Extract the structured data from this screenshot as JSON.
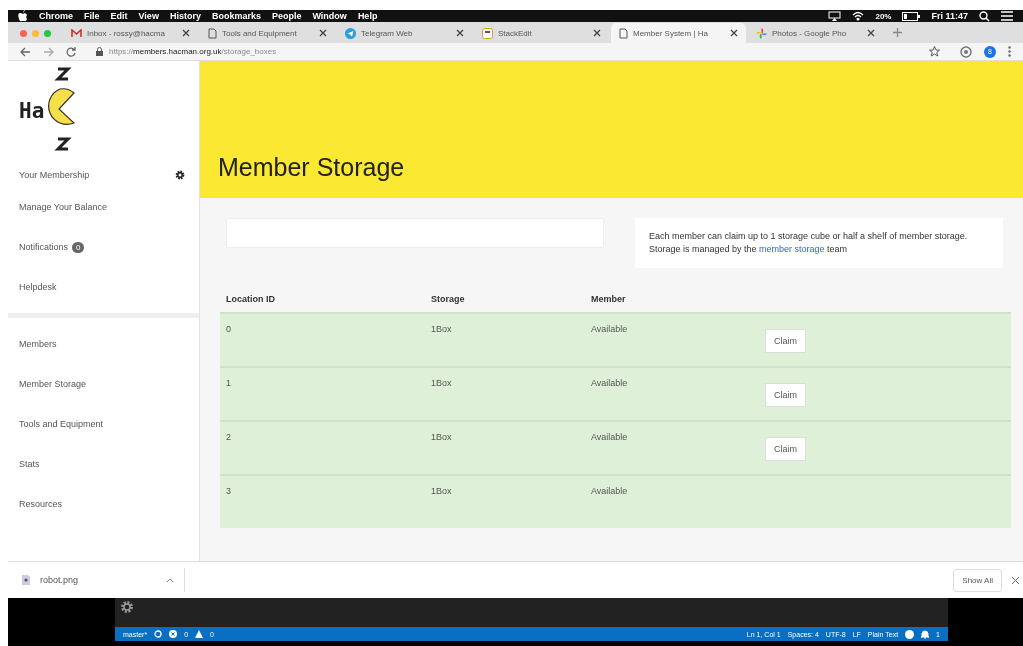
{
  "menu_bar": {
    "app": "Chrome",
    "items": [
      "File",
      "Edit",
      "View",
      "History",
      "Bookmarks",
      "People",
      "Window",
      "Help"
    ],
    "battery": "20%",
    "clock": "Fri 11:47"
  },
  "tabs": [
    {
      "label": "Inbox - rossy@hacma",
      "kind": "mail",
      "selected": false
    },
    {
      "label": "Tools and Equipment",
      "kind": "doc",
      "selected": false
    },
    {
      "label": "Telegram Web",
      "kind": "telegram",
      "selected": false
    },
    {
      "label": "StackEdit",
      "kind": "stackedit",
      "selected": false
    },
    {
      "label": "Member System | Ha",
      "kind": "doc",
      "selected": true
    },
    {
      "label": "Photos - Google Pho",
      "kind": "photos",
      "selected": false
    }
  ],
  "address_bar": {
    "scheme": "https://",
    "host": "members.hacman.org.uk",
    "path": "/storage_boxes",
    "profile": "8"
  },
  "logo": {
    "text": "Ha"
  },
  "sidebar": {
    "sections": [
      [
        {
          "label": "Your Membership",
          "kind": "settings"
        },
        {
          "label": "Manage Your Balance",
          "kind": "plain"
        },
        {
          "label": "Notifications",
          "kind": "badge",
          "badge": "0"
        },
        {
          "label": "Helpdesk",
          "kind": "plain"
        }
      ],
      [
        {
          "label": "Members",
          "kind": "plain"
        },
        {
          "label": "Member Storage",
          "kind": "plain"
        },
        {
          "label": "Tools and Equipment",
          "kind": "plain"
        },
        {
          "label": "Stats",
          "kind": "plain"
        },
        {
          "label": "Resources",
          "kind": "plain"
        }
      ]
    ]
  },
  "page": {
    "title": "Member Storage",
    "info": {
      "line1": "Each member can claim up to 1 storage cube or half a shelf of member storage.",
      "line2_before": "Storage is managed by the",
      "link": "member storage",
      "line2_after": "team"
    }
  },
  "table": {
    "columns": [
      "Location ID",
      "Storage",
      "Member"
    ],
    "rows": [
      {
        "location": "0",
        "storage": "1Box",
        "member": "Available",
        "action": "Claim"
      },
      {
        "location": "1",
        "storage": "1Box",
        "member": "Available",
        "action": "Claim"
      },
      {
        "location": "2",
        "storage": "1Box",
        "member": "Available",
        "action": "Claim"
      },
      {
        "location": "3",
        "storage": "1Box",
        "member": "Available"
      }
    ]
  },
  "download_bar": {
    "file": "robot.png",
    "show_all": "Show All"
  },
  "status_bar": {
    "branch": "master*",
    "errors": "0",
    "warnings": "0",
    "position": "Ln 1, Col 1",
    "spaces": "Spaces: 4",
    "encoding": "UTF-8",
    "eol": "LF",
    "language": "Plain Text",
    "notifications": "1"
  }
}
